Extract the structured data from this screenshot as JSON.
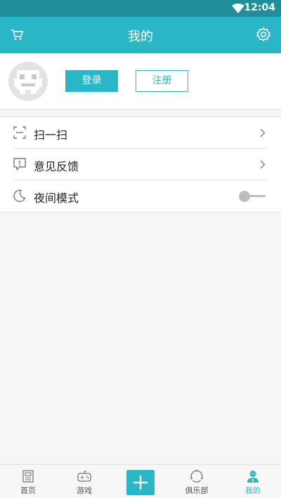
{
  "status_bar": {
    "time": "12:04"
  },
  "app_bar": {
    "title": "我的"
  },
  "profile": {
    "login_label": "登录",
    "register_label": "注册"
  },
  "menu": {
    "items": [
      {
        "label": "扫一扫"
      },
      {
        "label": "意见反馈"
      },
      {
        "label": "夜间模式"
      }
    ],
    "night_mode_on": false
  },
  "bottom_nav": {
    "tabs": [
      {
        "label": "首页"
      },
      {
        "label": "游戏"
      },
      {
        "label": "俱乐部"
      },
      {
        "label": "我的"
      }
    ],
    "active_tab": "我的"
  },
  "colors": {
    "accent": "#29b6c6",
    "status_bar": "#1f8e9b",
    "background": "#f5f5f5"
  },
  "icons": [
    "wifi-icon",
    "cart-icon",
    "gear-icon",
    "avatar",
    "scan-icon",
    "feedback-icon",
    "moon-icon",
    "chevron-right-icon",
    "home-icon",
    "gamepad-icon",
    "plus-icon",
    "club-icon",
    "user-icon"
  ]
}
